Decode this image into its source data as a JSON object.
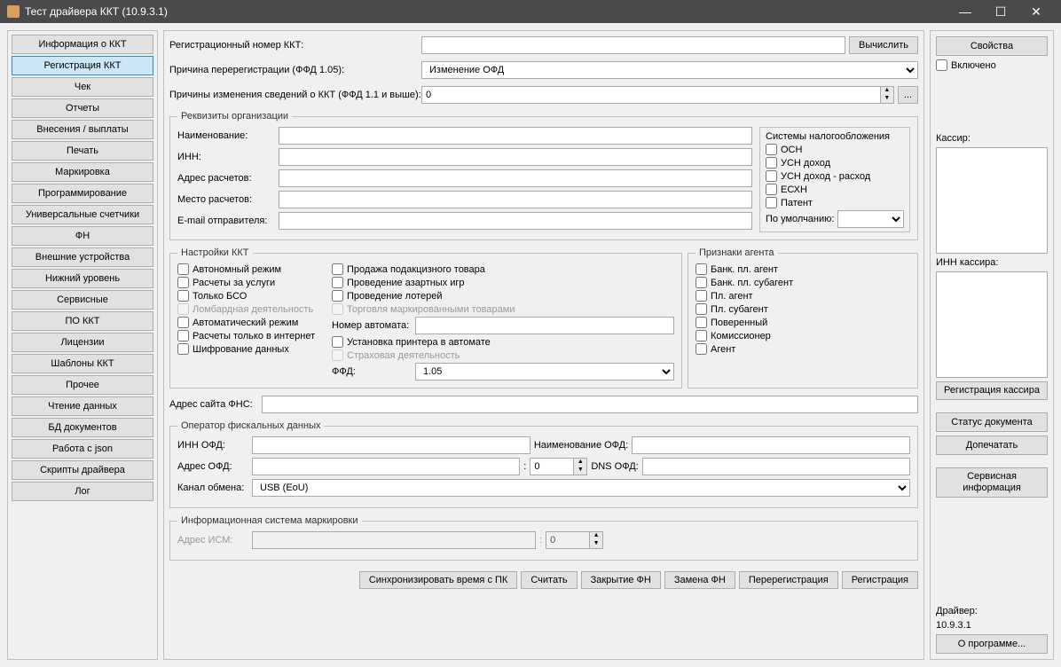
{
  "window": {
    "title": "Тест драйвера ККТ (10.9.3.1)"
  },
  "nav": [
    "Информация о ККТ",
    "Регистрация ККТ",
    "Чек",
    "Отчеты",
    "Внесения / выплаты",
    "Печать",
    "Маркировка",
    "Программирование",
    "Универсальные счетчики",
    "ФН",
    "Внешние устройства",
    "Нижний уровень",
    "Сервисные",
    "ПО ККТ",
    "Лицензии",
    "Шаблоны ККТ",
    "Прочее",
    "Чтение данных",
    "БД документов",
    "Работа с json",
    "Скрипты драйвера",
    "Лог"
  ],
  "nav_active": 1,
  "top": {
    "reg_num_label": "Регистрационный номер ККТ:",
    "reg_num_value": "",
    "calc_btn": "Вычислить",
    "rereg_reason_label": "Причина перерегистрации (ФФД 1.05):",
    "rereg_reason_value": "Изменение ОФД",
    "change_reasons_label": "Причины изменения сведений о ККТ (ФФД 1.1 и выше):",
    "change_reasons_value": "0",
    "ellipsis": "..."
  },
  "org": {
    "legend": "Реквизиты организации",
    "name_label": "Наименование:",
    "name_value": "",
    "inn_label": "ИНН:",
    "inn_value": "",
    "addr_label": "Адрес расчетов:",
    "addr_value": "",
    "place_label": "Место расчетов:",
    "place_value": "",
    "email_label": "E-mail отправителя:",
    "email_value": "",
    "tax_legend": "Системы налогообложения",
    "tax": [
      "ОСН",
      "УСН доход",
      "УСН доход - расход",
      "ЕСХН",
      "Патент"
    ],
    "default_label": "По умолчанию:"
  },
  "kkt": {
    "legend": "Настройки ККТ",
    "col1": [
      {
        "t": "Автономный режим",
        "d": false
      },
      {
        "t": "Расчеты за услуги",
        "d": false
      },
      {
        "t": "Только БСО",
        "d": false
      },
      {
        "t": "Ломбардная деятельность",
        "d": true
      },
      {
        "t": "Автоматический режим",
        "d": false
      },
      {
        "t": "Расчеты только в интернет",
        "d": false
      },
      {
        "t": "Шифрование данных",
        "d": false
      }
    ],
    "col2": [
      {
        "t": "Продажа подакцизного товара",
        "d": false
      },
      {
        "t": "Проведение азартных игр",
        "d": false
      },
      {
        "t": "Проведение лотерей",
        "d": false
      },
      {
        "t": "Торговля маркированными товарами",
        "d": true
      }
    ],
    "machine_label": "Номер автомата:",
    "machine_value": "",
    "printer_label": "Установка принтера в автомате",
    "insurance_label": "Страховая деятельность",
    "ffd_label": "ФФД:",
    "ffd_value": "1.05",
    "fns_label": "Адрес сайта ФНС:",
    "fns_value": ""
  },
  "agent": {
    "legend": "Признаки агента",
    "items": [
      "Банк. пл. агент",
      "Банк. пл. субагент",
      "Пл. агент",
      "Пл. субагент",
      "Поверенный",
      "Комиссионер",
      "Агент"
    ]
  },
  "ofd": {
    "legend": "Оператор фискальных данных",
    "inn_label": "ИНН ОФД:",
    "inn_value": "",
    "name_label": "Наименование ОФД:",
    "name_value": "",
    "addr_label": "Адрес ОФД:",
    "addr_value": "",
    "port_value": "0",
    "dns_label": "DNS ОФД:",
    "dns_value": "",
    "channel_label": "Канал обмена:",
    "channel_value": "USB (EoU)"
  },
  "ism": {
    "legend": "Информационная система маркировки",
    "addr_label": "Адрес ИСМ:",
    "addr_value": "",
    "port_value": "0"
  },
  "bottom_btns": [
    "Синхронизировать время с ПК",
    "Считать",
    "Закрытие ФН",
    "Замена ФН",
    "Перерегистрация",
    "Регистрация"
  ],
  "right": {
    "props_btn": "Свойства",
    "enabled_label": "Включено",
    "cashier_label": "Кассир:",
    "cashier_value": "",
    "cashier_inn_label": "ИНН кассира:",
    "cashier_inn_value": "",
    "reg_cashier_btn": "Регистрация кассира",
    "doc_status_btn": "Статус документа",
    "reprint_btn": "Допечатать",
    "service_info_btn": "Сервисная информация",
    "driver_label": "Драйвер:",
    "driver_version": "10.9.3.1",
    "about_btn": "О программе..."
  }
}
